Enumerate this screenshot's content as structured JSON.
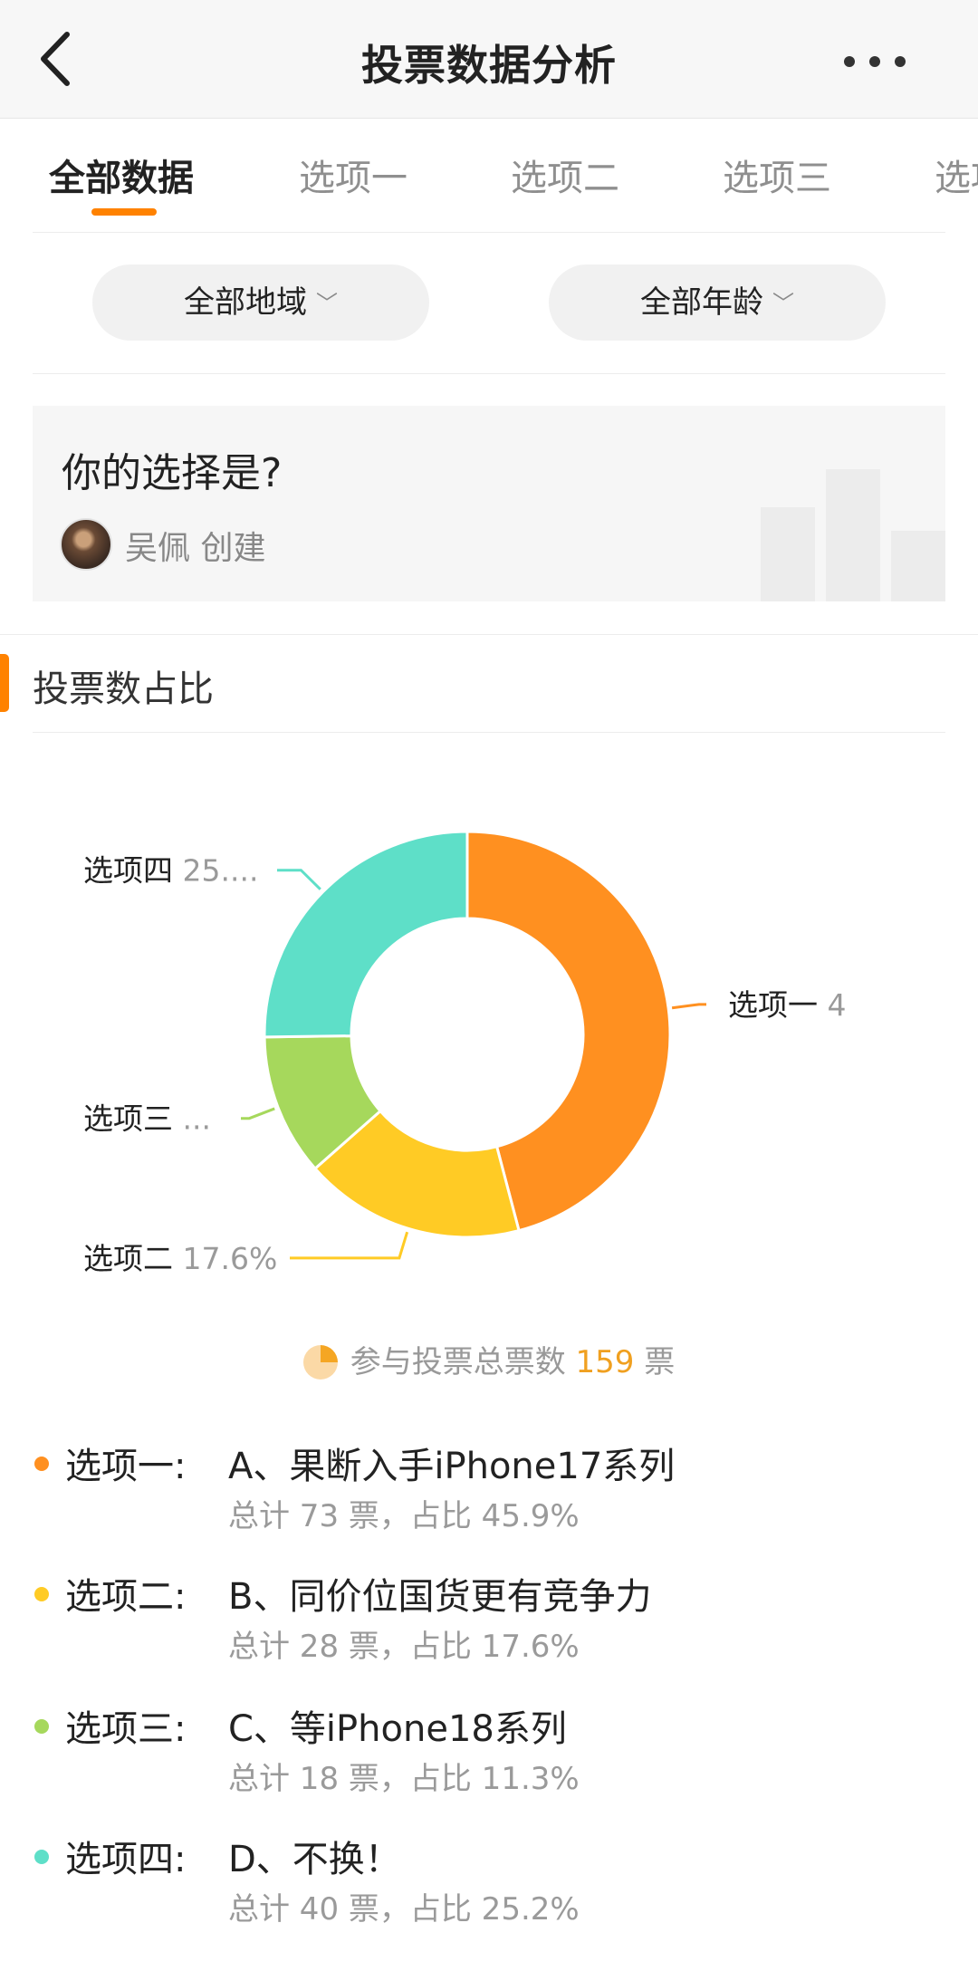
{
  "header": {
    "title": "投票数据分析"
  },
  "tabs": [
    {
      "label": "全部数据"
    },
    {
      "label": "选项一"
    },
    {
      "label": "选项二"
    },
    {
      "label": "选项三"
    },
    {
      "label": "选项四"
    }
  ],
  "filters": {
    "region": "全部地域",
    "age": "全部年龄"
  },
  "poll": {
    "question": "你的选择是?",
    "creator": "吴佩 创建"
  },
  "section": {
    "title": "投票数占比"
  },
  "colors": {
    "accent": "#ff8200",
    "option1": "#ff9020",
    "option2": "#ffcb25",
    "option3": "#a6d85c",
    "option4": "#5edfc8"
  },
  "chart_data": {
    "type": "pie",
    "style": "donut",
    "categories": [
      "选项一",
      "选项二",
      "选项三",
      "选项四"
    ],
    "values": [
      45.9,
      17.6,
      11.3,
      25.2
    ],
    "labels": [
      "4",
      "17.6%",
      "...",
      "25...."
    ],
    "title": ""
  },
  "total": {
    "prefix": "参与投票总票数",
    "count": "159",
    "unit": "票"
  },
  "options": [
    {
      "name": "选项一:",
      "text": "A、果断入手iPhone17系列",
      "stat": "总计 73 票，占比 45.9%",
      "color": "#ff9020"
    },
    {
      "name": "选项二:",
      "text": "B、同价位国货更有竞争力",
      "stat": "总计 28 票，占比 17.6%",
      "color": "#ffcb25"
    },
    {
      "name": "选项三:",
      "text": "C、等iPhone18系列",
      "stat": "总计 18 票，占比 11.3%",
      "color": "#a6d85c"
    },
    {
      "name": "选项四:",
      "text": "D、不换！",
      "stat": "总计 40 票，占比 25.2%",
      "color": "#5edfc8"
    }
  ]
}
